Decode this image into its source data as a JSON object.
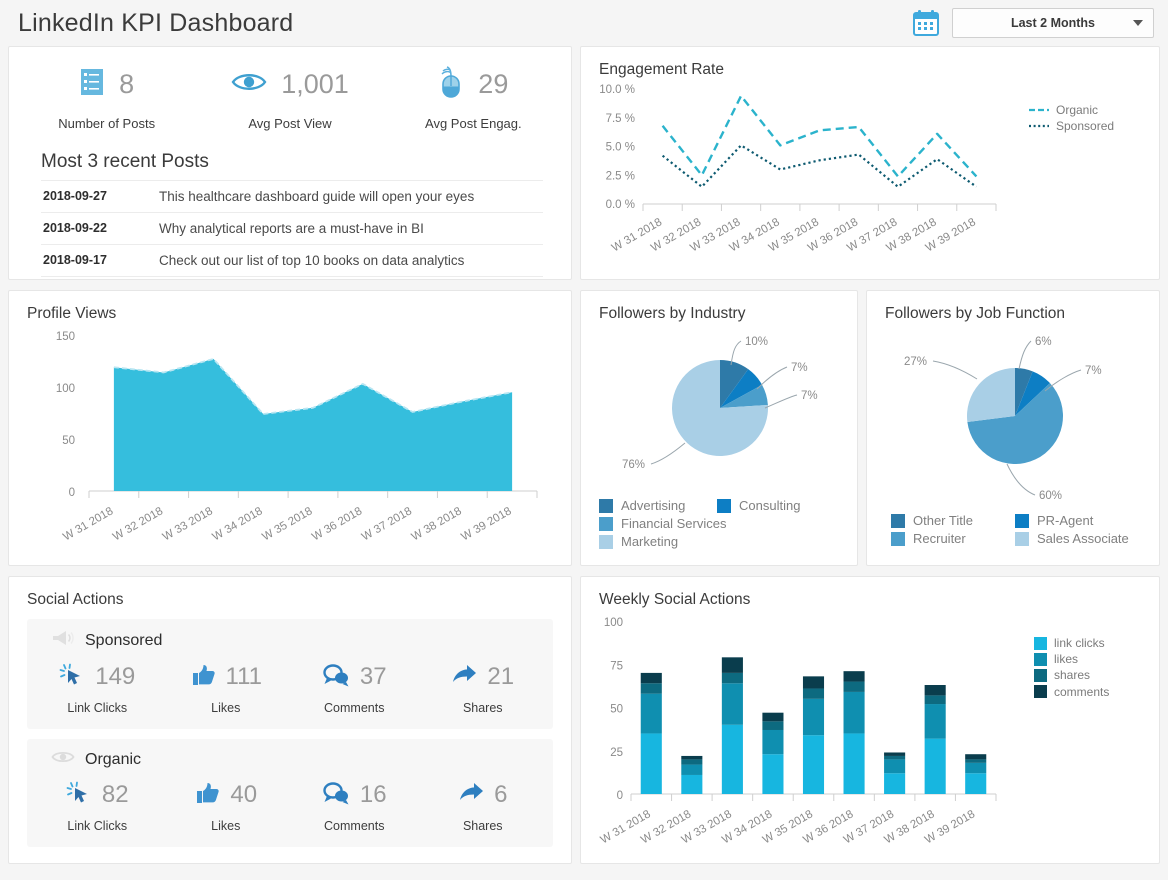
{
  "header": {
    "title": "LinkedIn KPI Dashboard",
    "calendar_icon": "calendar-icon",
    "date_range_value": "Last 2 Months",
    "date_range_options": [
      "Last 2 Months"
    ]
  },
  "kpi": {
    "items": [
      {
        "icon": "list-posts-icon",
        "value": "8",
        "label": "Number of Posts"
      },
      {
        "icon": "eye-icon",
        "value": "1,001",
        "label": "Avg Post View"
      },
      {
        "icon": "mouse-icon",
        "value": "29",
        "label": "Avg Post Engag."
      }
    ],
    "recent_heading": "Most 3 recent Posts",
    "recent_posts": [
      {
        "date": "2018-09-27",
        "text": "This healthcare dashboard guide will open your eyes"
      },
      {
        "date": "2018-09-22",
        "text": "Why analytical reports are a must-have in BI"
      },
      {
        "date": "2018-09-17",
        "text": "Check out our list of top 10 books on data analytics"
      }
    ]
  },
  "social_actions": {
    "title": "Social Actions",
    "groups": [
      {
        "icon": "megaphone-icon",
        "name": "Sponsored",
        "metrics": [
          {
            "icon": "click-cursor-icon",
            "value": "149",
            "label": "Link Clicks"
          },
          {
            "icon": "thumbs-up-icon",
            "value": "111",
            "label": "Likes"
          },
          {
            "icon": "comment-bubble-icon",
            "value": "37",
            "label": "Comments"
          },
          {
            "icon": "share-arrow-icon",
            "value": "21",
            "label": "Shares"
          }
        ]
      },
      {
        "icon": "eye-outline-icon",
        "name": "Organic",
        "metrics": [
          {
            "icon": "click-cursor-icon",
            "value": "82",
            "label": "Link Clicks"
          },
          {
            "icon": "thumbs-up-icon",
            "value": "40",
            "label": "Likes"
          },
          {
            "icon": "comment-bubble-icon",
            "value": "16",
            "label": "Comments"
          },
          {
            "icon": "share-arrow-icon",
            "value": "6",
            "label": "Shares"
          }
        ]
      }
    ]
  },
  "colors": {
    "organic_line": "#2bb3cc",
    "sponsored_line": "#0d5a70",
    "area_fill": "#35bedd",
    "link_clicks": "#17b6e0",
    "likes": "#0f8fb0",
    "shares": "#0d6a80",
    "comments": "#0a3d4d",
    "pie_advertising": "#2e7aa8",
    "pie_consulting": "#0d7ec4",
    "pie_financial": "#4b9ecb",
    "pie_marketing": "#a9cfe6",
    "pie_other_title": "#2e7aa8",
    "pie_pr_agent": "#0d7ec4",
    "pie_recruiter": "#4b9ecb",
    "pie_sales_associate": "#a9cfe6"
  },
  "chart_data": [
    {
      "id": "engagement-rate",
      "type": "line",
      "title": "Engagement Rate",
      "xlabel": "",
      "ylabel": "",
      "ylim": [
        0,
        10
      ],
      "yticks": [
        0,
        2.5,
        5,
        7.5,
        10
      ],
      "ytick_labels": [
        "0.0 %",
        "2.5 %",
        "5.0 %",
        "7.5 %",
        "10.0 %"
      ],
      "grid": false,
      "legend_position": "right",
      "categories": [
        "W 31 2018",
        "W 32 2018",
        "W 33 2018",
        "W 34 2018",
        "W 35 2018",
        "W 36 2018",
        "W 37 2018",
        "W 38 2018",
        "W 39 2018"
      ],
      "series": [
        {
          "name": "Organic",
          "style": "dashed",
          "values": [
            6.8,
            2.5,
            9.4,
            5.1,
            6.4,
            6.7,
            2.4,
            6.1,
            2.4
          ]
        },
        {
          "name": "Sponsored",
          "style": "dotted",
          "values": [
            4.2,
            1.5,
            5.1,
            3.0,
            3.8,
            4.3,
            1.5,
            3.9,
            1.5
          ]
        }
      ]
    },
    {
      "id": "profile-views",
      "type": "area",
      "title": "Profile Views",
      "xlabel": "",
      "ylabel": "",
      "ylim": [
        0,
        150
      ],
      "yticks": [
        0,
        50,
        100,
        150
      ],
      "ytick_labels": [
        "0",
        "50",
        "100",
        "150"
      ],
      "grid": false,
      "legend_position": "none",
      "categories": [
        "W 31 2018",
        "W 32 2018",
        "W 33 2018",
        "W 34 2018",
        "W 35 2018",
        "W 36 2018",
        "W 37 2018",
        "W 38 2018",
        "W 39 2018"
      ],
      "series": [
        {
          "name": "Profile Views",
          "values": [
            119,
            114,
            127,
            74,
            80,
            103,
            76,
            86,
            95
          ]
        }
      ]
    },
    {
      "id": "followers-by-industry",
      "type": "pie",
      "title": "Followers by Industry",
      "legend_position": "bottom",
      "labels": [
        "Advertising",
        "Consulting",
        "Financial Services",
        "Marketing"
      ],
      "values": [
        10,
        7,
        7,
        76
      ],
      "value_labels": [
        "10%",
        "7%",
        "7%",
        "76%"
      ]
    },
    {
      "id": "followers-by-job-function",
      "type": "pie",
      "title": "Followers by Job Function",
      "legend_position": "bottom",
      "labels": [
        "Other Title",
        "PR-Agent",
        "Recruiter",
        "Sales Associate"
      ],
      "values": [
        6,
        7,
        60,
        27
      ],
      "value_labels": [
        "6%",
        "7%",
        "60%",
        "27%"
      ]
    },
    {
      "id": "weekly-social-actions",
      "type": "bar",
      "stacked": true,
      "title": "Weekly Social Actions",
      "xlabel": "",
      "ylabel": "",
      "ylim": [
        0,
        100
      ],
      "yticks": [
        0,
        25,
        50,
        75,
        100
      ],
      "ytick_labels": [
        "0",
        "25",
        "50",
        "75",
        "100"
      ],
      "grid": false,
      "legend_position": "right",
      "categories": [
        "W 31 2018",
        "W 32 2018",
        "W 33 2018",
        "W 34 2018",
        "W 35 2018",
        "W 36 2018",
        "W 37 2018",
        "W 38 2018",
        "W 39 2018"
      ],
      "series": [
        {
          "name": "link clicks",
          "values": [
            35,
            11,
            40,
            23,
            34,
            35,
            12,
            32,
            12
          ]
        },
        {
          "name": "likes",
          "values": [
            23,
            6,
            24,
            14,
            21,
            24,
            8,
            20,
            6
          ]
        },
        {
          "name": "shares",
          "values": [
            6,
            3,
            6,
            5,
            6,
            6,
            2,
            5,
            2
          ]
        },
        {
          "name": "comments",
          "values": [
            6,
            2,
            9,
            5,
            7,
            6,
            2,
            6,
            3
          ]
        }
      ]
    }
  ]
}
